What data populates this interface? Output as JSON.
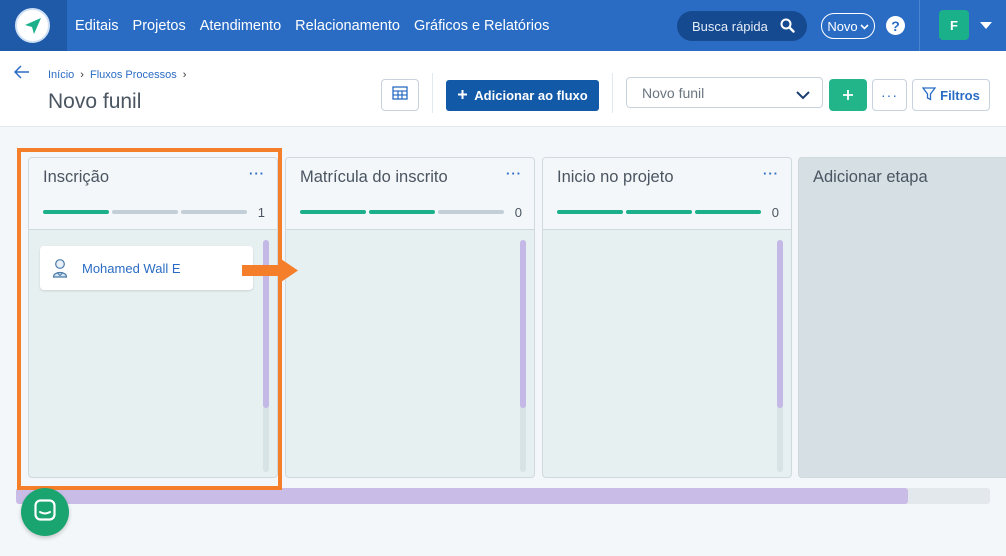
{
  "nav": {
    "items": [
      "Editais",
      "Projetos",
      "Atendimento",
      "Relacionamento",
      "Gráficos e Relatórios"
    ],
    "search_placeholder": "Busca rápida",
    "new_label": "Novo",
    "help_label": "?",
    "avatar_initial": "F",
    "brand_color": "#2a6cc4"
  },
  "header": {
    "breadcrumb": [
      "Início",
      "Fluxos Processos"
    ],
    "title": "Novo funil",
    "add_flow_label": "Adicionar ao fluxo",
    "funnel_select_value": "Novo funil",
    "more_label": "···",
    "filters_label": "Filtros"
  },
  "board": {
    "columns": [
      {
        "title": "Inscrição",
        "more": "···",
        "count": "1",
        "progress_filled": 1,
        "cards": [
          {
            "name": "Mohamed Wall E",
            "icon": "user-icon"
          }
        ]
      },
      {
        "title": "Matrícula do inscrito",
        "more": "···",
        "count": "0",
        "progress_filled": 2,
        "cards": []
      },
      {
        "title": "Inicio no projeto",
        "more": "···",
        "count": "0",
        "progress_filled": 3,
        "cards": []
      }
    ],
    "add_stage_label": "Adicionar etapa"
  },
  "colors": {
    "highlight": "#f47e2a",
    "accent_green": "#1bb08b",
    "primary_button": "#1259a8"
  }
}
